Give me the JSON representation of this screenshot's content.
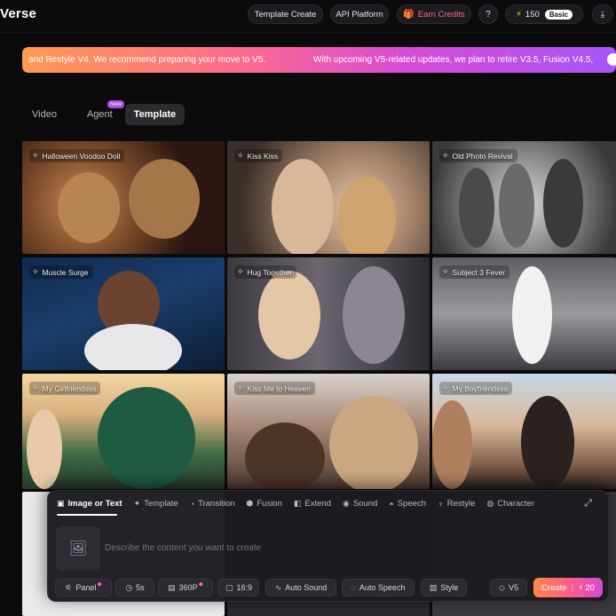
{
  "header": {
    "brand": "Verse",
    "template_create": "Template Create",
    "api_platform": "API Platform",
    "earn_credits": "Earn Credits",
    "credits": "150",
    "plan_badge": "Basic"
  },
  "banner": {
    "text_left": "and Restyle V4. We recommend preparing your move to V5.",
    "text_right": "With upcoming V5-related updates, we plan to retire V3.5, Fusion V4.5,"
  },
  "tabs": {
    "video": "Video",
    "agent": "Agent",
    "agent_badge": "New",
    "template": "Template",
    "active": "Template"
  },
  "templates": [
    {
      "label": "Halloween Voodoo Doll"
    },
    {
      "label": "Kiss Kiss"
    },
    {
      "label": "Old Photo Revival"
    },
    {
      "label": "Muscle Surge"
    },
    {
      "label": "Hug Together"
    },
    {
      "label": "Subject 3 Fever"
    },
    {
      "label": "My Girlfriendsss"
    },
    {
      "label": "Kiss Me to Heaven"
    },
    {
      "label": "My Boyfriendsss"
    }
  ],
  "composer": {
    "tabs": {
      "image_or_text": "Image or Text",
      "template": "Template",
      "transition": "Transition",
      "fusion": "Fusion",
      "extend": "Extend",
      "sound": "Sound",
      "speech": "Speech",
      "restyle": "Restyle",
      "character": "Character"
    },
    "placeholder": "Describe the content you want to create",
    "options": {
      "panel": "Panel",
      "duration": "5s",
      "resolution": "360P",
      "ratio": "16:9",
      "auto_sound": "Auto Sound",
      "auto_speech": "Auto Speech",
      "style": "Style",
      "model": "V5"
    },
    "create_label": "Create",
    "create_cost": "20"
  },
  "colors": {
    "accent_gradient_start": "#ff8a4a",
    "accent_gradient_end": "#d24bd8",
    "earn_credits": "#ff6a86",
    "new_badge": "#a84ce0"
  }
}
